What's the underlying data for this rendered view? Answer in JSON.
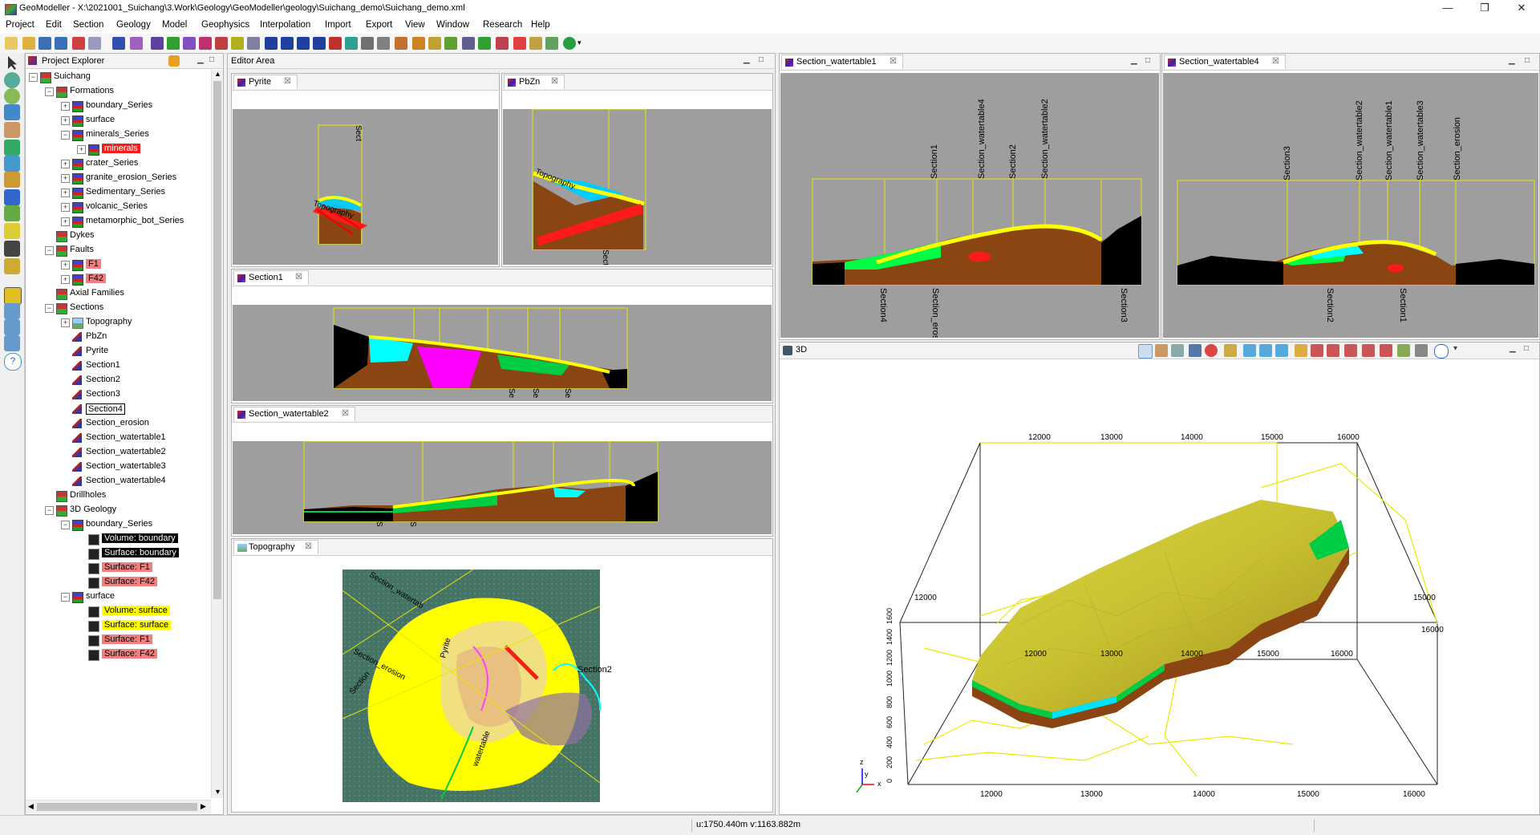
{
  "window": {
    "title": "GeoModeller - X:\\2021001_Suichang\\3.Work\\Geology\\GeoModeller\\geology\\Suichang_demo\\Suichang_demo.xml",
    "min": "—",
    "max": "❐",
    "close": "✕"
  },
  "menu": [
    "Project",
    "Edit",
    "Section",
    "Geology",
    "Model",
    "Geophysics",
    "Interpolation",
    "Import",
    "Export",
    "View",
    "Window",
    "Research",
    "Help"
  ],
  "project_explorer": {
    "title": "Project Explorer",
    "tree": [
      {
        "label": "Suichang",
        "level": 0,
        "exp": "−",
        "icon": "folder"
      },
      {
        "label": "Formations",
        "level": 1,
        "exp": "−",
        "icon": "folder"
      },
      {
        "label": "boundary_Series",
        "level": 2,
        "exp": "+",
        "icon": "form"
      },
      {
        "label": "surface",
        "level": 2,
        "exp": "+",
        "icon": "form"
      },
      {
        "label": "minerals_Series",
        "level": 2,
        "exp": "−",
        "icon": "form"
      },
      {
        "label": "minerals",
        "level": 3,
        "exp": "+",
        "icon": "form",
        "hl": "red"
      },
      {
        "label": "crater_Series",
        "level": 2,
        "exp": "+",
        "icon": "form"
      },
      {
        "label": "granite_erosion_Series",
        "level": 2,
        "exp": "+",
        "icon": "form"
      },
      {
        "label": "Sedimentary_Series",
        "level": 2,
        "exp": "+",
        "icon": "form"
      },
      {
        "label": "volcanic_Series",
        "level": 2,
        "exp": "+",
        "icon": "form"
      },
      {
        "label": "metamorphic_bot_Series",
        "level": 2,
        "exp": "+",
        "icon": "form"
      },
      {
        "label": "Dykes",
        "level": 1,
        "exp": "",
        "icon": "folder"
      },
      {
        "label": "Faults",
        "level": 1,
        "exp": "−",
        "icon": "folder"
      },
      {
        "label": "F1",
        "level": 2,
        "exp": "+",
        "icon": "form",
        "hl": "pink"
      },
      {
        "label": "F42",
        "level": 2,
        "exp": "+",
        "icon": "form",
        "hl": "pink"
      },
      {
        "label": "Axial Families",
        "level": 1,
        "exp": "",
        "icon": "folder"
      },
      {
        "label": "Sections",
        "level": 1,
        "exp": "−",
        "icon": "folder"
      },
      {
        "label": "Topography",
        "level": 2,
        "exp": "+",
        "icon": "topo"
      },
      {
        "label": "PbZn",
        "level": 2,
        "exp": "",
        "icon": "sec"
      },
      {
        "label": "Pyrite",
        "level": 2,
        "exp": "",
        "icon": "sec"
      },
      {
        "label": "Section1",
        "level": 2,
        "exp": "",
        "icon": "sec"
      },
      {
        "label": "Section2",
        "level": 2,
        "exp": "",
        "icon": "sec"
      },
      {
        "label": "Section3",
        "level": 2,
        "exp": "",
        "icon": "sec"
      },
      {
        "label": "Section4",
        "level": 2,
        "exp": "",
        "icon": "sec",
        "hl": "box"
      },
      {
        "label": "Section_erosion",
        "level": 2,
        "exp": "",
        "icon": "sec"
      },
      {
        "label": "Section_watertable1",
        "level": 2,
        "exp": "",
        "icon": "sec"
      },
      {
        "label": "Section_watertable2",
        "level": 2,
        "exp": "",
        "icon": "sec"
      },
      {
        "label": "Section_watertable3",
        "level": 2,
        "exp": "",
        "icon": "sec"
      },
      {
        "label": "Section_watertable4",
        "level": 2,
        "exp": "",
        "icon": "sec"
      },
      {
        "label": "Drillholes",
        "level": 1,
        "exp": "",
        "icon": "folder"
      },
      {
        "label": "3D Geology",
        "level": 1,
        "exp": "−",
        "icon": "folder"
      },
      {
        "label": "boundary_Series",
        "level": 2,
        "exp": "−",
        "icon": "form"
      },
      {
        "label": "Volume: boundary",
        "level": 3,
        "exp": "",
        "icon": "vol",
        "hl": "black"
      },
      {
        "label": "Surface: boundary",
        "level": 3,
        "exp": "",
        "icon": "vol",
        "hl": "black"
      },
      {
        "label": "Surface: F1",
        "level": 3,
        "exp": "",
        "icon": "vol",
        "hl": "pink"
      },
      {
        "label": "Surface: F42",
        "level": 3,
        "exp": "",
        "icon": "vol",
        "hl": "pink"
      },
      {
        "label": "surface",
        "level": 2,
        "exp": "−",
        "icon": "form"
      },
      {
        "label": "Volume: surface",
        "level": 3,
        "exp": "",
        "icon": "vol",
        "hl": "yel"
      },
      {
        "label": "Surface: surface",
        "level": 3,
        "exp": "",
        "icon": "vol",
        "hl": "yel"
      },
      {
        "label": "Surface: F1",
        "level": 3,
        "exp": "",
        "icon": "vol",
        "hl": "pink"
      },
      {
        "label": "Surface: F42",
        "level": 3,
        "exp": "",
        "icon": "vol",
        "hl": "pink"
      }
    ]
  },
  "editor": {
    "title": "Editor Area",
    "pyrite_tab": "Pyrite",
    "pbzn_tab": "PbZn",
    "section1_tab": "Section1",
    "watertable2_tab": "Section_watertable2",
    "topography_tab": "Topography",
    "labels": {
      "sect": "Sect",
      "topography": "Topography",
      "s": "S",
      "se": "Se",
      "section": "Section",
      "section2": "Section2",
      "pyrite": "Pyrite",
      "watertable": "watertable",
      "section_erosion": "Section_erosion",
      "section_watertable": "Section_watertab"
    }
  },
  "wt1": {
    "tab": "Section_watertable1",
    "labels": [
      "Section1",
      "Section_watertable4",
      "Section2",
      "Section_watertable2"
    ],
    "bottom": [
      "Section4",
      "Section_erosion",
      "Section3"
    ]
  },
  "wt4": {
    "tab": "Section_watertable4",
    "labels": [
      "Section3",
      "Section_watertable2",
      "Section_watertable1",
      "Section_watertable3",
      "Section_erosion"
    ],
    "bottom": [
      "Section2",
      "Section1"
    ]
  },
  "view3d": {
    "tab": "3D",
    "top_ticks": [
      "12000",
      "13000",
      "14000",
      "15000",
      "16000"
    ],
    "bottom_ticks": [
      "12000",
      "13000",
      "14000",
      "15000",
      "16000"
    ],
    "mid_ticks": [
      "12000",
      "13000",
      "14000",
      "15000",
      "16000"
    ],
    "z_ticks": [
      "0",
      "200",
      "400",
      "600",
      "800",
      "1000",
      "1200",
      "1400",
      "1600"
    ],
    "axes": {
      "z": "z",
      "y": "y",
      "x": "x"
    }
  },
  "status": {
    "coords": "u:1750.440m v:1163.882m"
  },
  "colors": {
    "accent": "#ff1a1a",
    "section_bg": "#9e9e9e",
    "topo": "#ffff00",
    "frame": "#d8d800"
  }
}
